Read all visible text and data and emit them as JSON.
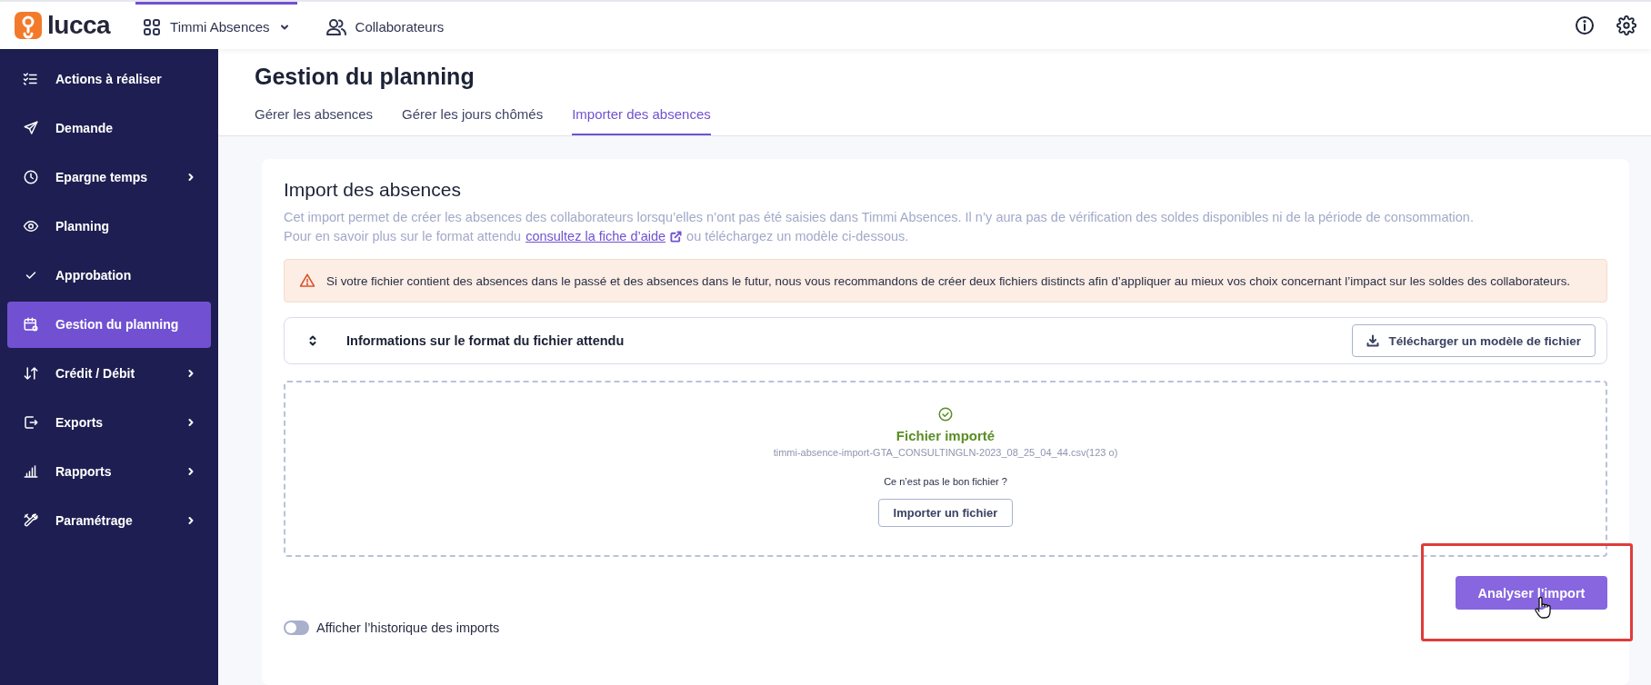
{
  "topbar": {
    "logo": "lucca",
    "product": "Timmi Absences",
    "product_selected": true,
    "people": "Collaborateurs"
  },
  "sidebar": {
    "items": [
      {
        "label": "Actions à réaliser",
        "selected": false,
        "submenu": false
      },
      {
        "label": "Demande",
        "selected": false,
        "submenu": false
      },
      {
        "label": "Epargne temps",
        "selected": false,
        "submenu": true
      },
      {
        "label": "Planning",
        "selected": false,
        "submenu": false
      },
      {
        "label": "Approbation",
        "selected": false,
        "submenu": false
      },
      {
        "label": "Gestion du planning",
        "selected": true,
        "submenu": false
      },
      {
        "label": "Crédit / Débit",
        "selected": false,
        "submenu": true
      },
      {
        "label": "Exports",
        "selected": false,
        "submenu": true
      },
      {
        "label": "Rapports",
        "selected": false,
        "submenu": true
      },
      {
        "label": "Paramétrage",
        "selected": false,
        "submenu": true
      }
    ]
  },
  "page": {
    "title": "Gestion du planning",
    "tabs": [
      {
        "label": "Gérer les absences",
        "selected": false
      },
      {
        "label": "Gérer les jours chômés",
        "selected": false
      },
      {
        "label": "Importer des absences",
        "selected": true
      }
    ]
  },
  "card": {
    "title": "Import des absences",
    "description": "Cet import permet de créer les absences des collaborateurs lorsqu’elles n’ont pas été saisies dans Timmi Absences. Il n’y aura pas de vérification des soldes disponibles ni de la période de consommation.",
    "help": {
      "before": "Pour en savoir plus sur le format attendu",
      "link": "consultez la fiche d’aide",
      "after": "ou téléchargez un modèle ci-dessous."
    },
    "warning": "Si votre fichier contient des absences dans le passé et des absences dans le futur, nous vous recommandons de créer deux fichiers distincts afin d’appliquer au mieux vos choix concernant l’impact sur les soldes des collaborateurs.",
    "format_panel": {
      "title": "Informations sur le format du fichier attendu",
      "expanded": false,
      "download_button": "Télécharger un modèle de fichier"
    },
    "dropzone": {
      "status": "Fichier importé",
      "file": "timmi-absence-import-GTA_CONSULTINGLN-2023_08_25_04_44.csv(123 o)",
      "question": "Ce n’est pas le bon fichier ?",
      "button": "Importer un fichier"
    },
    "analyze_button": {
      "label": "Analyser l'import",
      "highlighted": true
    },
    "history_toggle": {
      "label": "Afficher l’historique des imports",
      "on": false
    }
  }
}
